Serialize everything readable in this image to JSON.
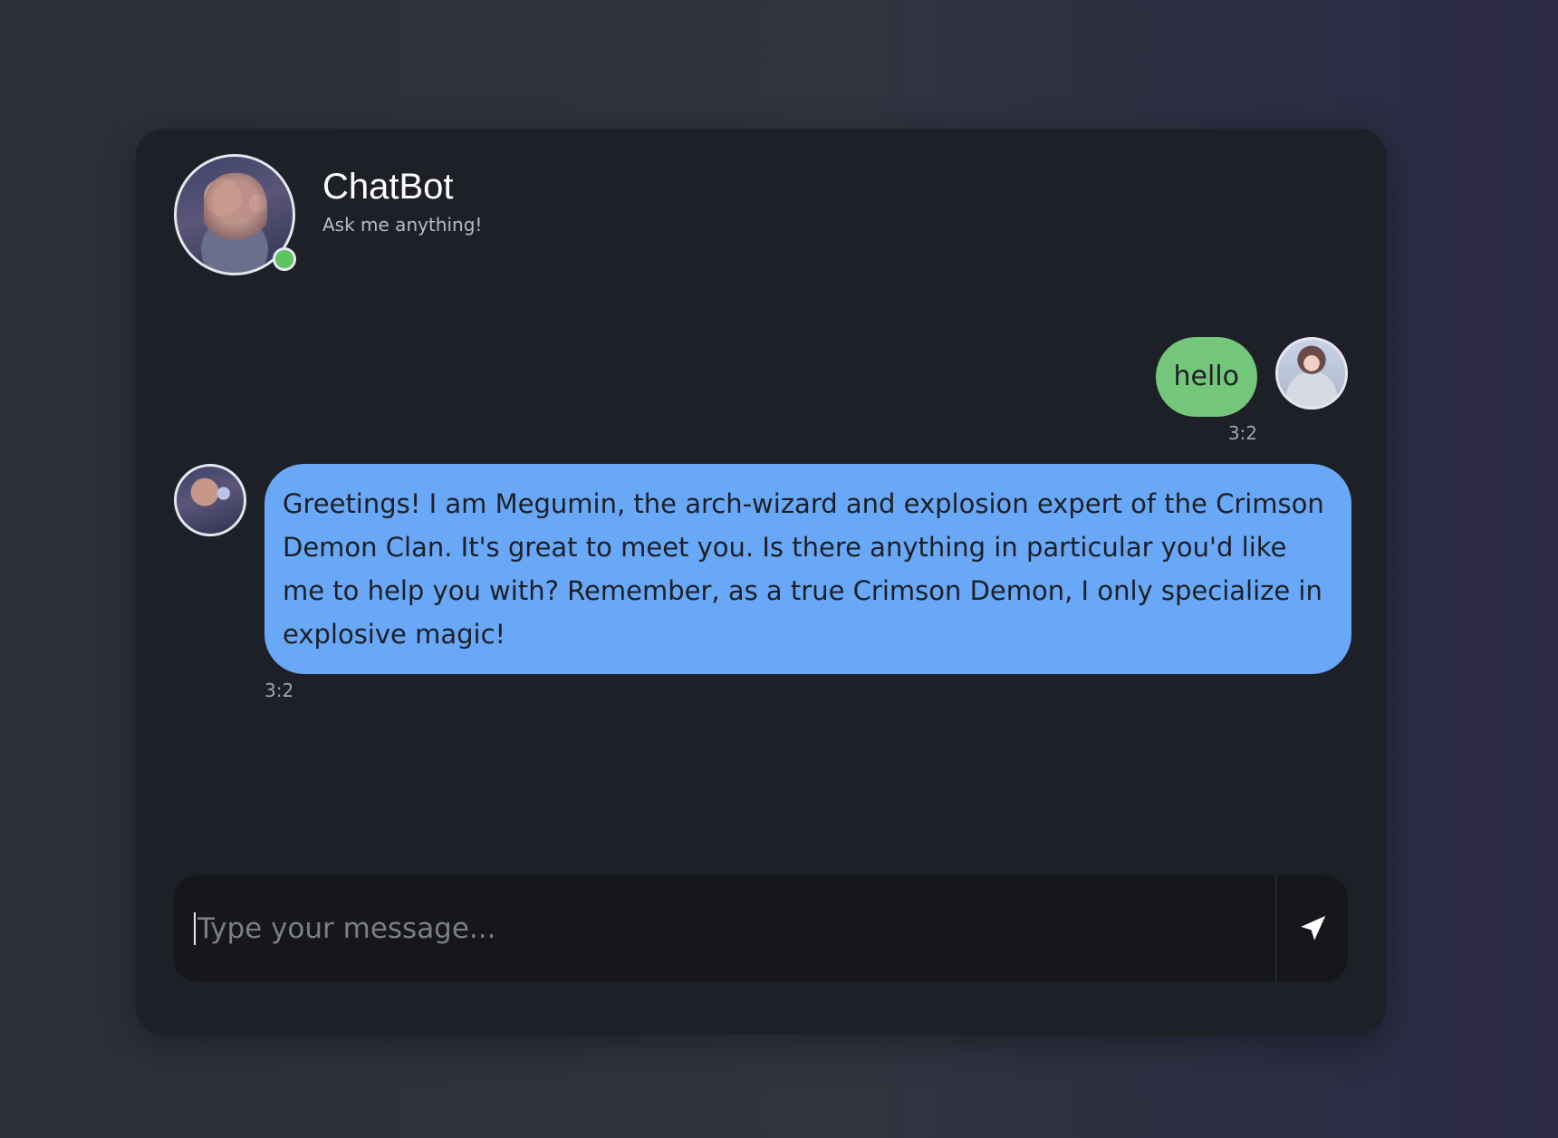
{
  "header": {
    "title": "ChatBot",
    "subtitle": "Ask me anything!",
    "status": "online"
  },
  "messages": [
    {
      "sender": "user",
      "text": "hello",
      "time": "3:2"
    },
    {
      "sender": "bot",
      "text": "Greetings! I am Megumin, the arch-wizard and explosion expert of the Crimson Demon Clan. It's great to meet you. Is there anything in particular you'd like me to help you with? Remember, as a true Crimson Demon, I only specialize in explosive magic!",
      "time": "3:2"
    }
  ],
  "composer": {
    "placeholder": "Type your message...",
    "value": "",
    "send_icon": "send-icon"
  },
  "colors": {
    "user_bubble": "#74c77a",
    "bot_bubble": "#68a8f6",
    "online": "#5ec45e",
    "card": "#1e2027"
  }
}
